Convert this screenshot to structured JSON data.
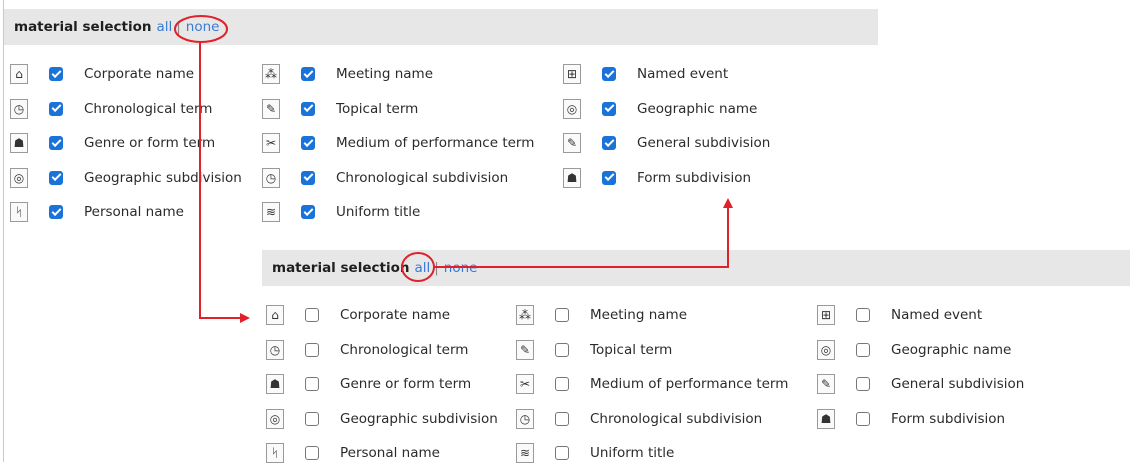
{
  "accent_color": "#e0202a",
  "panels": [
    {
      "title": "material selection",
      "all_label": "all",
      "separator": "|",
      "none_label": "none",
      "checked": true,
      "items": [
        {
          "label": "Corporate name",
          "icon": "corporate-name-icon",
          "glyph": "⌂"
        },
        {
          "label": "Meeting name",
          "icon": "meeting-name-icon",
          "glyph": "⁂"
        },
        {
          "label": "Named event",
          "icon": "named-event-icon",
          "glyph": "⊞"
        },
        {
          "label": "Chronological term",
          "icon": "chronological-term-icon",
          "glyph": "◷"
        },
        {
          "label": "Topical term",
          "icon": "topical-term-icon",
          "glyph": "✎"
        },
        {
          "label": "Geographic name",
          "icon": "geographic-name-icon",
          "glyph": "◎"
        },
        {
          "label": "Genre or form term",
          "icon": "genre-form-term-icon",
          "glyph": "☗"
        },
        {
          "label": "Medium of performance term",
          "icon": "medium-of-performance-icon",
          "glyph": "✂"
        },
        {
          "label": "General subdivision",
          "icon": "general-subdivision-icon",
          "glyph": "✎"
        },
        {
          "label": "Geographic subdivision",
          "icon": "geographic-subdivision-icon",
          "glyph": "◎"
        },
        {
          "label": "Chronological subdivision",
          "icon": "chronological-subdivision-icon",
          "glyph": "◷"
        },
        {
          "label": "Form subdivision",
          "icon": "form-subdivision-icon",
          "glyph": "☗"
        },
        {
          "label": "Personal name",
          "icon": "personal-name-icon",
          "glyph": "ᛋ"
        },
        {
          "label": "Uniform title",
          "icon": "uniform-title-icon",
          "glyph": "≋"
        }
      ]
    },
    {
      "title": "material selection",
      "all_label": "all",
      "separator": "|",
      "none_label": "none",
      "checked": false,
      "items": [
        {
          "label": "Corporate name",
          "icon": "corporate-name-icon",
          "glyph": "⌂"
        },
        {
          "label": "Meeting name",
          "icon": "meeting-name-icon",
          "glyph": "⁂"
        },
        {
          "label": "Named event",
          "icon": "named-event-icon",
          "glyph": "⊞"
        },
        {
          "label": "Chronological term",
          "icon": "chronological-term-icon",
          "glyph": "◷"
        },
        {
          "label": "Topical term",
          "icon": "topical-term-icon",
          "glyph": "✎"
        },
        {
          "label": "Geographic name",
          "icon": "geographic-name-icon",
          "glyph": "◎"
        },
        {
          "label": "Genre or form term",
          "icon": "genre-form-term-icon",
          "glyph": "☗"
        },
        {
          "label": "Medium of performance term",
          "icon": "medium-of-performance-icon",
          "glyph": "✂"
        },
        {
          "label": "General subdivision",
          "icon": "general-subdivision-icon",
          "glyph": "✎"
        },
        {
          "label": "Geographic subdivision",
          "icon": "geographic-subdivision-icon",
          "glyph": "◎"
        },
        {
          "label": "Chronological subdivision",
          "icon": "chronological-subdivision-icon",
          "glyph": "◷"
        },
        {
          "label": "Form subdivision",
          "icon": "form-subdivision-icon",
          "glyph": "☗"
        },
        {
          "label": "Personal name",
          "icon": "personal-name-icon",
          "glyph": "ᛋ"
        },
        {
          "label": "Uniform title",
          "icon": "uniform-title-icon",
          "glyph": "≋"
        }
      ]
    }
  ]
}
